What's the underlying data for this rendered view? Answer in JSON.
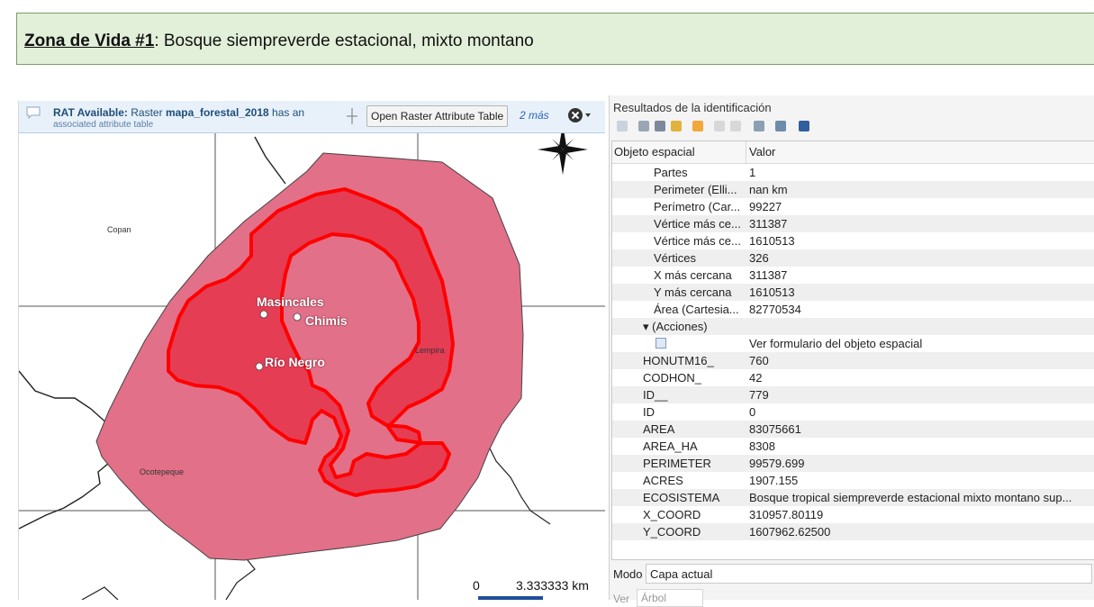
{
  "banner": {
    "zona": "Zona de Vida #1",
    "desc": ": Bosque siempreverde estacional, mixto montano"
  },
  "rat_bar": {
    "label": "RAT Available:",
    "message": "Raster mapa_forestal_2018 has an",
    "message_bold_part": "mapa_forestal_2018",
    "message_sub": "associated attribute table",
    "button": "Open Raster Attribute Table",
    "more": "2 más"
  },
  "map": {
    "labels": {
      "copan": "Copan",
      "ocotepeque": "Ocotepeque",
      "lempira": "Lempira"
    },
    "towns": {
      "masincales": "Masincales",
      "chimis": "Chimis",
      "rio_negro": "Río Negro"
    },
    "scale": {
      "zero": "0",
      "km": "3.333333 km"
    },
    "colors": {
      "outer_polygon": "#e27088",
      "zone_fill": "#e53d54",
      "zone_outline": "#ff0000"
    }
  },
  "identify": {
    "title": "Resultados de la identificación",
    "header": {
      "feature": "Objeto espacial",
      "value": "Valor"
    },
    "rows": [
      {
        "field": "Partes",
        "value": "1",
        "indent": 2
      },
      {
        "field": "Perimeter (Elli...",
        "value": "nan km",
        "indent": 2
      },
      {
        "field": "Perímetro (Car...",
        "value": "99227",
        "indent": 2
      },
      {
        "field": "Vértice más ce...",
        "value": "311387",
        "indent": 2
      },
      {
        "field": "Vértice más ce...",
        "value": "1610513",
        "indent": 2
      },
      {
        "field": "Vértices",
        "value": "326",
        "indent": 2
      },
      {
        "field": "X más cercana",
        "value": "311387",
        "indent": 2
      },
      {
        "field": "Y más cercana",
        "value": "1610513",
        "indent": 2
      },
      {
        "field": "Área (Cartesia...",
        "value": "82770534",
        "indent": 2
      },
      {
        "field": "▾ (Acciones)",
        "value": "",
        "indent": 1
      },
      {
        "field": "",
        "value": "Ver formulario del objeto espacial",
        "indent": 2,
        "icon": true
      },
      {
        "field": "HONUTM16_",
        "value": "760",
        "indent": 1
      },
      {
        "field": "CODHON_",
        "value": "42",
        "indent": 1
      },
      {
        "field": "ID__",
        "value": "779",
        "indent": 1
      },
      {
        "field": "ID",
        "value": "0",
        "indent": 1
      },
      {
        "field": "AREA",
        "value": "83075661",
        "indent": 1
      },
      {
        "field": "AREA_HA",
        "value": "8308",
        "indent": 1
      },
      {
        "field": "PERIMETER",
        "value": "99579.699",
        "indent": 1
      },
      {
        "field": "ACRES",
        "value": "1907.155",
        "indent": 1
      },
      {
        "field": "ECOSISTEMA",
        "value": "Bosque tropical siempreverde estacional mixto montano sup...",
        "indent": 1
      },
      {
        "field": "X_COORD",
        "value": "310957.80119",
        "indent": 1
      },
      {
        "field": "Y_COORD",
        "value": "1607962.62500",
        "indent": 1
      }
    ],
    "mode_label": "Modo",
    "mode_value": "Capa actual",
    "view_label": "Ver",
    "view_value": "Árbol"
  }
}
